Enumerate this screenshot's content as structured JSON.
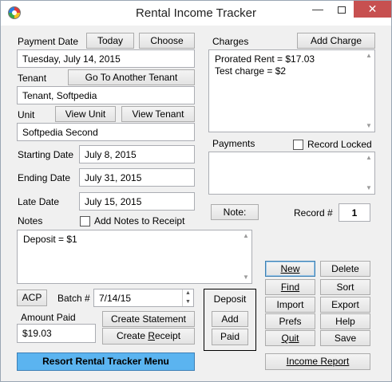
{
  "window": {
    "title": "Rental Income Tracker",
    "minimize_glyph": "—",
    "close_glyph": "✕"
  },
  "payment_date": {
    "label": "Payment Date",
    "today_button": "Today",
    "choose_button": "Choose",
    "value": "Tuesday, July 14, 2015"
  },
  "tenant": {
    "label": "Tenant",
    "goto_button": "Go To Another Tenant",
    "value": "Tenant, Softpedia"
  },
  "unit": {
    "label": "Unit",
    "view_unit_button": "View Unit",
    "view_tenant_button": "View Tenant",
    "value": "Softpedia Second"
  },
  "dates": {
    "starting_label": "Starting Date",
    "starting_value": "July 8, 2015",
    "ending_label": "Ending Date",
    "ending_value": "July 31, 2015",
    "late_label": "Late Date",
    "late_value": "July 15, 2015"
  },
  "notes": {
    "label": "Notes",
    "add_to_receipt_label": "Add Notes to Receipt",
    "add_to_receipt_checked": false,
    "text": "Deposit = $1"
  },
  "charges": {
    "label": "Charges",
    "add_button": "Add Charge",
    "lines": [
      "Prorated Rent = $17.03",
      "Test charge = $2"
    ]
  },
  "payments": {
    "label": "Payments",
    "record_locked_label": "Record Locked",
    "record_locked_checked": false,
    "lines": []
  },
  "note_button": "Note:",
  "record": {
    "label": "Record #",
    "value": "1"
  },
  "acp_button": "ACP",
  "batch": {
    "label": "Batch #",
    "value": "7/14/15"
  },
  "amount_paid": {
    "label": "Amount Paid",
    "value": "$19.03"
  },
  "statement_button": "Create Statement",
  "receipt_button": {
    "pre": "Create ",
    "ul": "R",
    "post": "eceipt"
  },
  "deposit": {
    "label": "Deposit",
    "add_button": "Add",
    "paid_button": "Paid"
  },
  "actions": {
    "new": "New",
    "delete": "Delete",
    "find": "Find",
    "sort": "Sort",
    "import": "Import",
    "export": "Export",
    "prefs": "Prefs",
    "help": "Help",
    "quit": "Quit",
    "save": "Save",
    "income_report": "Income Report"
  },
  "resort_menu_button": "Resort Rental Tracker Menu",
  "colors": {
    "accent_button": "#5bb4f0",
    "close_button": "#c75050",
    "window_bg": "#f0f0f0"
  }
}
